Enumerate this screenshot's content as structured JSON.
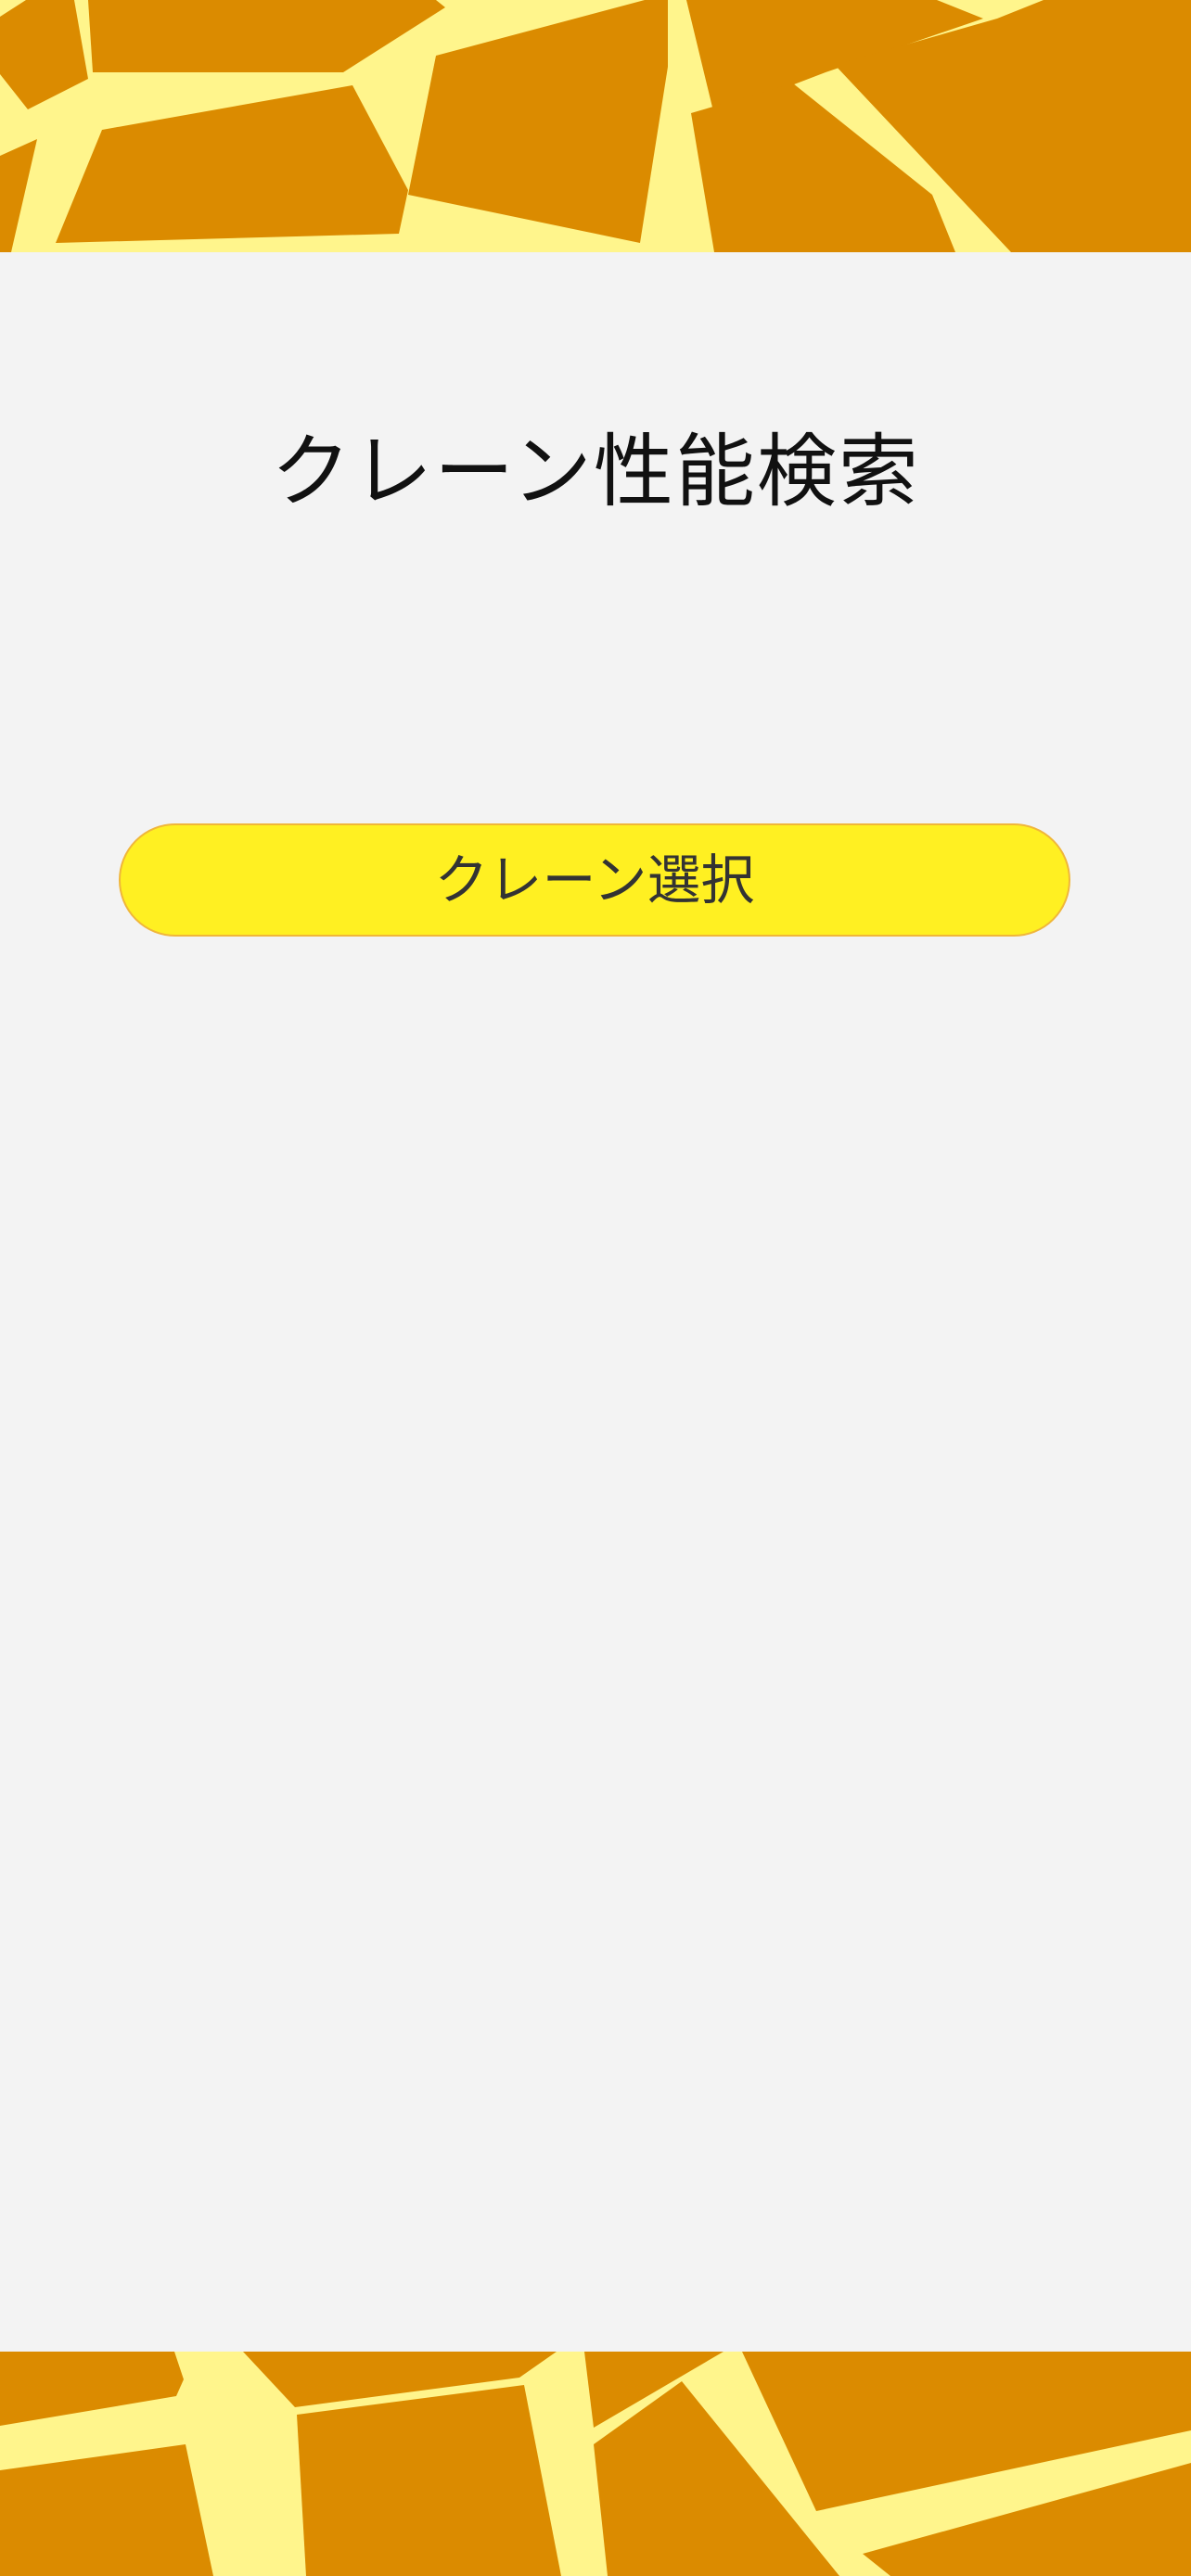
{
  "header": {
    "banner_icon": "giraffe-pattern",
    "colors": {
      "pattern_fill": "#db8b00",
      "pattern_lines": "#fff58c"
    }
  },
  "main": {
    "title": "クレーン性能検索",
    "crane_select_label": "クレーン選択",
    "button_color": "#fff022"
  },
  "footer": {
    "banner_icon": "giraffe-pattern"
  }
}
